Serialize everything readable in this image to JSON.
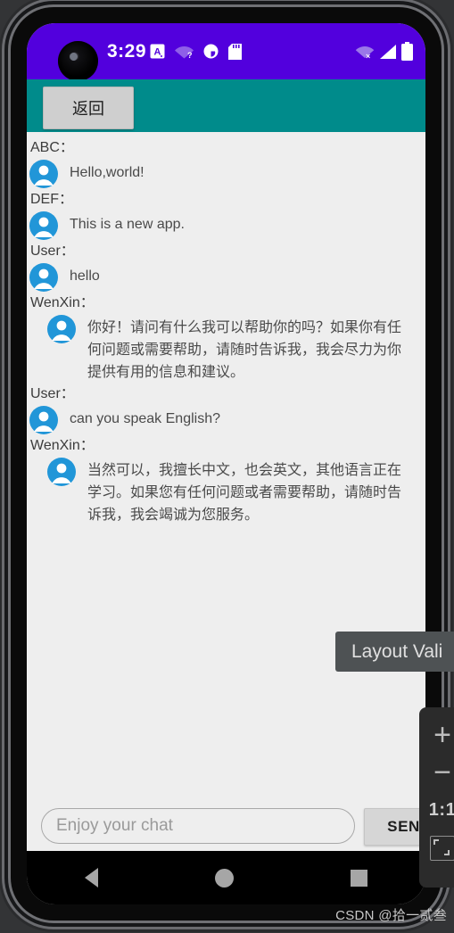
{
  "status_bar": {
    "clock": "3:29",
    "left_icons": [
      "input-method-a-icon",
      "wifi-question-icon",
      "contrast-circle-icon",
      "sd-card-icon"
    ],
    "right_icons": [
      "wifi-off-icon",
      "cellular-signal-icon",
      "battery-full-icon"
    ],
    "background_color": "#5200dd"
  },
  "app_bar": {
    "background_color": "#008b8b",
    "back_label": "返回"
  },
  "chat": {
    "messages": [
      {
        "sender": "ABC：",
        "text": "Hello,world!",
        "indent": false,
        "avatar": "user-avatar-icon"
      },
      {
        "sender": "DEF：",
        "text": "This is a new app.",
        "indent": false,
        "avatar": "user-avatar-icon"
      },
      {
        "sender": "User：",
        "text": "hello",
        "indent": false,
        "avatar": "user-avatar-icon"
      },
      {
        "sender": "WenXin：",
        "text": "你好！请问有什么我可以帮助你的吗？如果你有任何问题或需要帮助，请随时告诉我，我会尽力为你提供有用的信息和建议。",
        "indent": true,
        "avatar": "user-avatar-icon"
      },
      {
        "sender": "User：",
        "text": "can you speak English?",
        "indent": false,
        "avatar": "user-avatar-icon"
      },
      {
        "sender": "WenXin：",
        "text": "当然可以，我擅长中文，也会英文，其他语言正在学习。如果您有任何问题或者需要帮助，请随时告诉我，我会竭诚为您服务。",
        "indent": true,
        "avatar": "user-avatar-icon"
      }
    ]
  },
  "composer": {
    "input_value": "",
    "input_placeholder": "Enjoy your chat",
    "send_label": "SEND"
  },
  "nav_bar": {
    "back": "nav-back-icon",
    "home": "nav-home-icon",
    "recents": "nav-recents-icon"
  },
  "overlays": {
    "tooltip_text": "Layout Vali",
    "zoom_in": "+",
    "zoom_out": "−",
    "zoom_ratio": "1:1",
    "zoom_fit": "fit-to-screen-icon"
  },
  "watermark": "CSDN @拾一贰叁",
  "colors": {
    "accent_purple": "#5200dd",
    "accent_teal": "#008b8b",
    "avatar_blue": "#2196d8",
    "screen_background": "#eeeeee"
  }
}
